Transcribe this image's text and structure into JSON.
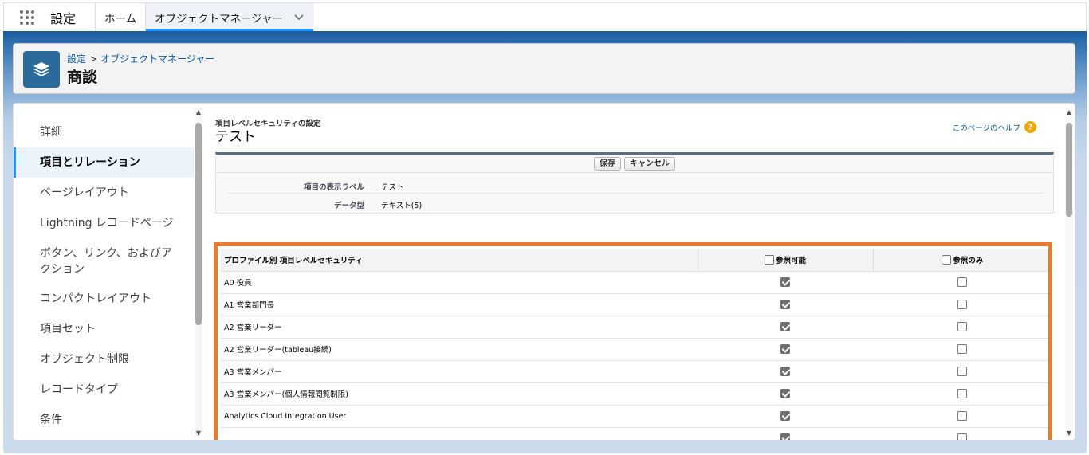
{
  "topnav": {
    "app_name": "設定",
    "tabs": [
      {
        "label": "ホーム"
      },
      {
        "label": "オブジェクトマネージャー"
      }
    ]
  },
  "header": {
    "breadcrumb": [
      "設定",
      "オブジェクトマネージャー"
    ],
    "breadcrumb_separator": ">",
    "title": "商談"
  },
  "sidebar": {
    "items": [
      {
        "label": "詳細",
        "active": false
      },
      {
        "label": "項目とリレーション",
        "active": true
      },
      {
        "label": "ページレイアウト",
        "active": false
      },
      {
        "label": "Lightning レコードページ",
        "active": false
      },
      {
        "label": "ボタン、リンク、およびア\nクション",
        "active": false
      },
      {
        "label": "コンパクトレイアウト",
        "active": false
      },
      {
        "label": "項目セット",
        "active": false
      },
      {
        "label": "オブジェクト制限",
        "active": false
      },
      {
        "label": "レコードタイプ",
        "active": false
      },
      {
        "label": "条件",
        "active": false
      }
    ]
  },
  "content": {
    "subtitle": "項目レベルセキュリティの設定",
    "title": "テスト",
    "help_link": "このページのヘルプ",
    "help_icon": "?",
    "buttons": {
      "save": "保存",
      "cancel": "キャンセル"
    },
    "details": [
      {
        "label": "項目の表示ラベル",
        "value": "テスト"
      },
      {
        "label": "データ型",
        "value": "テキスト(5)"
      }
    ]
  },
  "fls_table": {
    "headers": {
      "profile": "プロファイル別 項目レベルセキュリティ",
      "visible": "参照可能",
      "readonly": "参照のみ"
    },
    "rows": [
      {
        "profile": "A0 役員",
        "visible": true,
        "readonly": false
      },
      {
        "profile": "A1 営業部門長",
        "visible": true,
        "readonly": false
      },
      {
        "profile": "A2 営業リーダー",
        "visible": true,
        "readonly": false
      },
      {
        "profile": "A2 営業リーダー(tableau接続)",
        "visible": true,
        "readonly": false
      },
      {
        "profile": "A3 営業メンバー",
        "visible": true,
        "readonly": false
      },
      {
        "profile": "A3 営業メンバー(個人情報閲覧制限)",
        "visible": true,
        "readonly": false
      },
      {
        "profile": "Analytics Cloud Integration User",
        "visible": true,
        "readonly": false
      }
    ]
  },
  "colors": {
    "highlight_frame": "#ec7a2e",
    "brand_blue": "#1d5b9a",
    "link": "#0b5cab"
  }
}
